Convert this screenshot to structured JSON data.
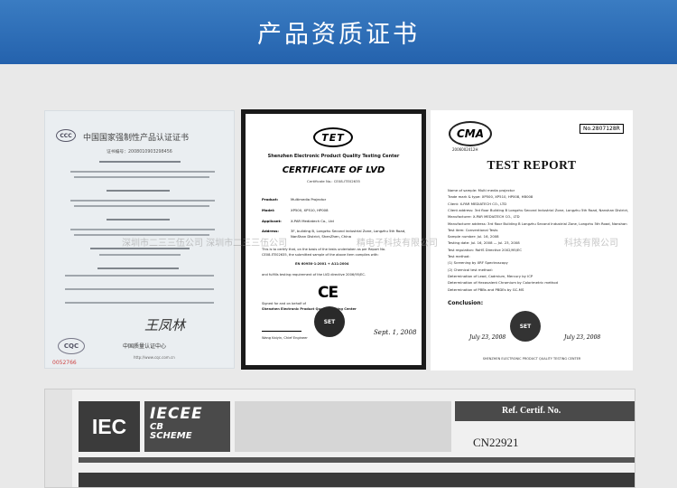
{
  "header": {
    "title": "产品资质证书",
    "bg_color": "#2e6db4"
  },
  "watermark": {
    "text": "深圳市二三三伍公司   深圳市二三三伍公司",
    "text_right": "科技有限公司",
    "text_mid": "精电子科技有限公司"
  },
  "cert_ccc": {
    "logo": "CCC",
    "title": "中国国家强制性产品认证证书",
    "number": "证书编号：2008010903298456",
    "seal_text": "CQC",
    "signature": "王凤林",
    "issuer": "中国质量认证中心",
    "footer": "http://www.cqc.com.cn",
    "serial": "0052766"
  },
  "cert_lvd": {
    "logo": "TET",
    "center_name": "Shenzhen Electronic Product Quality Testing Center",
    "title": "CERTIFICATE OF LVD",
    "cert_no": "Certificate No.: CE08-ITE02635",
    "product_label": "Product:",
    "product": "Multimedia Projector",
    "model_label": "Model:",
    "model": "XP500, XP510, HP008",
    "applicant_label": "Applicant:",
    "applicant": "X-PAR Mediatech Co., Ltd",
    "address_label": "Address:",
    "address_1": "3F, building B, Longzhu Second industrial Zone, Longzhu 5th Road,",
    "address_2": "NanShan District, ShenZhen, China",
    "body_1": "This is to certify that, on the basis of the tests undertaken as per Report No.",
    "body_2": "CE08-ITE02635, the submitted sample of the above item complies with:",
    "standard": "EN 60950-1:2001 + A11:2004",
    "body_3": "and fulfills testing requirement of the LVD directive 2006/95/EC.",
    "ce_mark": "CE",
    "signed": "Signed for and on behalf of",
    "signed_2": "Shenzhen Electronic Product Quality Testing Center",
    "seal_text": "SET",
    "signer_name": "Wang Kaiyin, Chief Engineer",
    "date": "Sept. 1, 2008"
  },
  "cert_report": {
    "logo": "CMA",
    "logo_no": "2006002412H",
    "report_no": "No.2807128R",
    "title": "TEST REPORT",
    "rows": [
      "Name of sample: Multi media projector",
      "Trade mark & type: XP500, XP510, HP008, HB008",
      "Client: X-PAR MEDIATECH CO., LTD",
      "Client address: 3rd floor Building B Longzhu Second Industrial Zone, Longzhu 5th Road, Nanshan District,",
      "Manufacturer: X-PAR MEDIATECH CO., LTD",
      "Manufacturer address: 3rd floor Building B Longzhu Second Industrial Zone, Longzhu 5th Road, Nanshan",
      "Test item: Conventional Tests",
      "Sample number: Jul. 16, 2008",
      "Testing date: Jul. 16, 2008 — Jul. 23, 2008",
      "Test regulation: RoHS Directive 2002/95/EC",
      "Test method:",
      "(1) Screening by XRF Spectroscopy",
      "(2) Chemical test method:",
      "Determination of Lead, Cadmium, Mercury by ICP",
      "Determination of Hexavalent Chromium by Colorimetric method",
      "Determination of PBBs and PBDEs by GC-MS"
    ],
    "conclusion": "Conclusion:",
    "seal_text": "SET",
    "checker": "July 23, 2008",
    "approver": "July 23, 2008",
    "footer": "SHENZHEN ELECTRONIC PRODUCT QUALITY TESTING CENTER"
  },
  "cert_cb": {
    "iec": "IEC",
    "iecee": "IECEE",
    "cb": "CB",
    "scheme": "SCHEME",
    "ref_label": "Ref. Certif. No.",
    "ref_value": "CN22921"
  }
}
